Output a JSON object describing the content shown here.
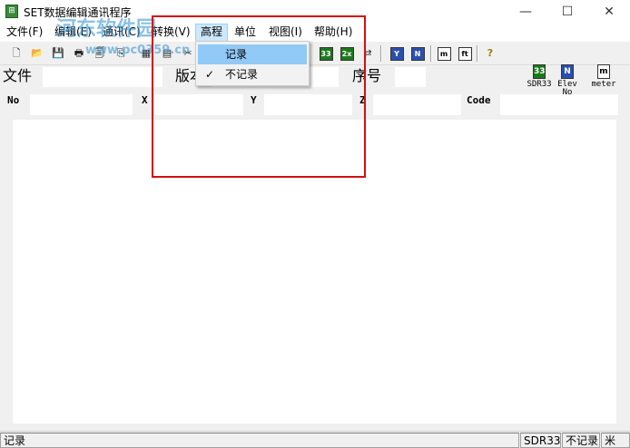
{
  "window": {
    "title": "SET数据编辑通讯程序",
    "minimize_glyph": "—",
    "maximize_glyph": "☐",
    "close_glyph": "✕"
  },
  "menubar": {
    "items": [
      {
        "label": "文件(F)"
      },
      {
        "label": "编辑(E)"
      },
      {
        "label": "通讯(C)"
      },
      {
        "label": "转换(V)"
      },
      {
        "label": "高程"
      },
      {
        "label": "单位"
      },
      {
        "label": "视图(I)"
      },
      {
        "label": "帮助(H)"
      }
    ]
  },
  "elevation_menu": {
    "items": [
      {
        "label": "记录",
        "checked": false
      },
      {
        "label": "不记录",
        "checked": true
      }
    ],
    "check_glyph": "✓"
  },
  "toolbar": {
    "buttons": [
      {
        "icon": "new-file-icon",
        "glyph": "🗋"
      },
      {
        "icon": "open-folder-icon",
        "glyph": "📂"
      },
      {
        "icon": "save-icon",
        "glyph": "💾"
      },
      {
        "icon": "print-icon",
        "glyph": "🖶"
      },
      {
        "icon": "print-preview-icon",
        "glyph": "🗐"
      },
      {
        "icon": "copy-icon",
        "glyph": "⎘"
      },
      {
        "icon": "receive-data-icon",
        "glyph": "▦"
      },
      {
        "icon": "send-data-icon",
        "glyph": "▤"
      },
      {
        "icon": "cut-icon",
        "glyph": "✂"
      },
      {
        "icon": "sdr33-icon",
        "glyph": "33"
      },
      {
        "icon": "sdr2x-icon",
        "glyph": "2x"
      },
      {
        "icon": "sdr-convert-icon",
        "glyph": "⇄"
      },
      {
        "icon": "elev-yes-icon",
        "glyph": "Y"
      },
      {
        "icon": "elev-no-icon",
        "glyph": "N"
      },
      {
        "icon": "meter-icon",
        "glyph": "m"
      },
      {
        "icon": "feet-icon",
        "glyph": "ft"
      },
      {
        "icon": "help-icon",
        "glyph": "?"
      }
    ]
  },
  "info_row": {
    "file_label": "文件",
    "version_label": "版本",
    "sequence_label": "序号"
  },
  "status_icons": [
    {
      "icon": "sdr33-status-icon",
      "glyph": "33",
      "caption": "SDR33"
    },
    {
      "icon": "elevation-no-status-icon",
      "glyph": "N",
      "caption": "Elev No"
    },
    {
      "icon": "meter-status-icon",
      "glyph": "m",
      "caption": "meter"
    }
  ],
  "columns": [
    {
      "label": "No"
    },
    {
      "label": "X"
    },
    {
      "label": "Y"
    },
    {
      "label": "Z"
    },
    {
      "label": "Code"
    }
  ],
  "statusbar": {
    "message": "记录",
    "format": "SDR33",
    "elevation": "不记录",
    "unit": "米"
  },
  "watermark": {
    "site_name": "河东软件园",
    "url": "www.pc0359.cn"
  },
  "colors": {
    "highlight_box": "#d21010",
    "menu_hover": "#91c9f7",
    "watermark": "#2b8fd1"
  }
}
